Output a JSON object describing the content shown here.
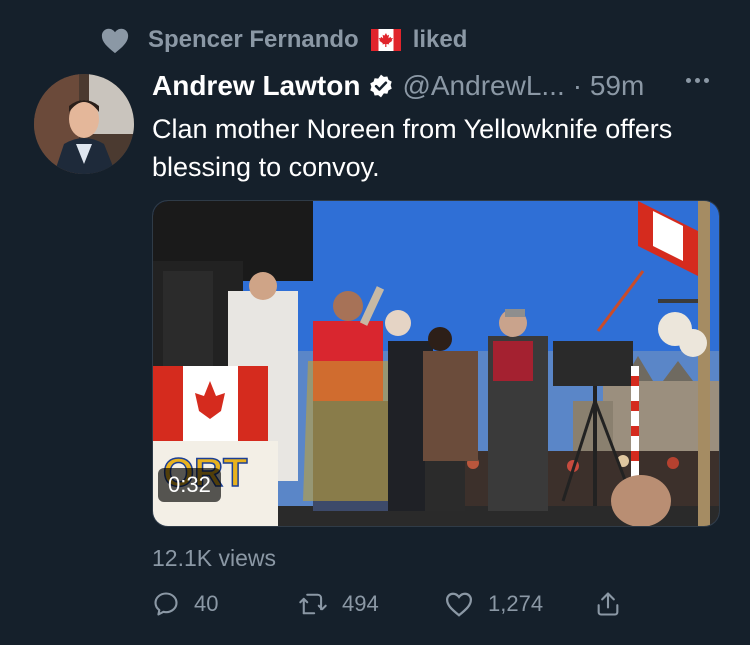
{
  "social_context": {
    "liker_name": "Spencer Fernando",
    "text": "liked",
    "icon": "heart-icon",
    "flag_icon": "canada-flag-icon"
  },
  "tweet": {
    "author_name": "Andrew Lawton",
    "verified_icon": "verified-badge-icon",
    "handle": "@AndrewL...",
    "time": "· 59m",
    "text": "Clan mother Noreen from Yellowknife offers blessing to convoy.",
    "video_duration": "0:32",
    "views": "12.1K views"
  },
  "actions": {
    "reply_count": "40",
    "retweet_count": "494",
    "like_count": "1,274"
  },
  "colors": {
    "background": "#15202b",
    "secondary_text": "#8b98a5",
    "primary_text": "#ffffff"
  }
}
